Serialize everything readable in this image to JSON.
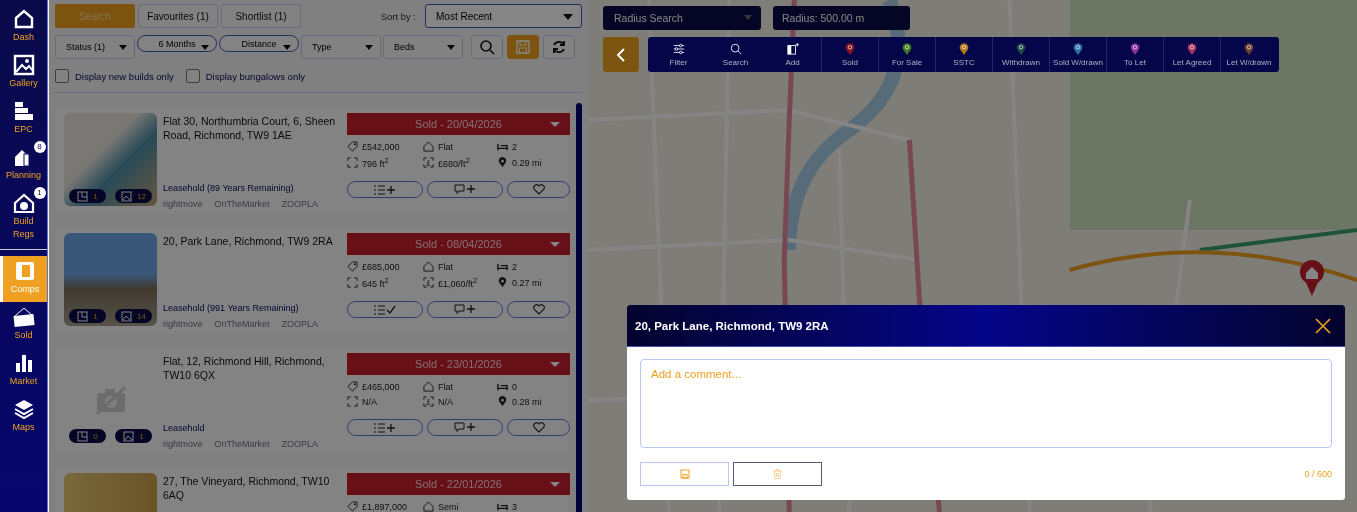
{
  "sidebar": {
    "items": [
      {
        "label": "Dash",
        "selected": false
      },
      {
        "label": "Gallery",
        "selected": false
      },
      {
        "label": "EPC",
        "selected": false
      },
      {
        "label": "Planning",
        "selected": false,
        "badge": "8"
      },
      {
        "label": "Build Regs",
        "selected": false,
        "badge": "1"
      },
      {
        "label": "Comps",
        "selected": true
      },
      {
        "label": "Sold",
        "selected": false
      },
      {
        "label": "Market",
        "selected": false
      },
      {
        "label": "Maps",
        "selected": false
      }
    ]
  },
  "tabs": [
    {
      "label": "Search",
      "selected": true
    },
    {
      "label": "Favourites (1)",
      "selected": false
    },
    {
      "label": "Shortlist (1)",
      "selected": false
    }
  ],
  "sort": {
    "label": "Sort by :",
    "value": "Most Recent"
  },
  "filters": [
    {
      "label": "Status (1)",
      "active": false
    },
    {
      "label": "6 Months",
      "active": true
    },
    {
      "label": "Distance",
      "active": true
    },
    {
      "label": "Type",
      "active": false
    },
    {
      "label": "Beds",
      "active": false
    }
  ],
  "checkboxes": [
    {
      "label": "Display new builds only",
      "checked": false
    },
    {
      "label": "Display bungalows only",
      "checked": false
    }
  ],
  "listings": [
    {
      "address": "Flat 30, Northumbria Court, 6, Sheen Road, Richmond, TW9 1AE",
      "status": "Sold - 20/04/2026",
      "price": "£542,000",
      "type": "Flat",
      "beds": "2",
      "area": "796 ft$^{2}$",
      "price_per_area": "£680/ft$^{2}$",
      "distance": "0.29 mi",
      "tenure": "Leasehold (89 Years Remaining)",
      "floorplans": "1",
      "photos": "12",
      "has_photo": true,
      "shortlisted": false,
      "portals": [
        "rightmove",
        "OnTheMarket",
        "ZOOPLA"
      ]
    },
    {
      "address": "20, Park Lane, Richmond, TW9 2RA",
      "status": "Sold - 08/04/2026",
      "price": "£685,000",
      "type": "Flat",
      "beds": "2",
      "area": "645 ft$^{2}$",
      "price_per_area": "£1,060/ft$^{2}$",
      "distance": "0.27 mi",
      "tenure": "Leasehold (991 Years Remaining)",
      "floorplans": "1",
      "photos": "14",
      "has_photo": true,
      "shortlisted": true,
      "portals": [
        "rightmove",
        "OnTheMarket",
        "ZOOPLA"
      ]
    },
    {
      "address": "Flat, 12, Richmond Hill, Richmond, TW10 6QX",
      "status": "Sold - 23/01/2026",
      "price": "£465,000",
      "type": "Flat",
      "beds": "0",
      "area": "N/A",
      "price_per_area": "N/A",
      "distance": "0.28 mi",
      "tenure": "Leasehold",
      "floorplans": "0",
      "photos": "1",
      "has_photo": false,
      "shortlisted": false,
      "portals": [
        "rightmove",
        "OnTheMarket",
        "ZOOPLA"
      ]
    },
    {
      "address": "27, The Vineyard, Richmond, TW10 6AQ",
      "status": "Sold - 22/01/2026",
      "price": "£1,897,000",
      "type": "Semi",
      "beds": "3",
      "has_photo": true
    }
  ],
  "map": {
    "search_mode": "Radius Search",
    "radius": "Radius: 500.00 m",
    "toolbar": [
      {
        "kind": "tool",
        "label": "Filter"
      },
      {
        "kind": "tool",
        "label": "Search"
      },
      {
        "kind": "tool",
        "label": "Add"
      },
      {
        "kind": "marker",
        "label": "Sold",
        "color": "#8a1520"
      },
      {
        "kind": "marker",
        "label": "For Sale",
        "color": "#3f7a1e"
      },
      {
        "kind": "marker",
        "label": "SSTC",
        "color": "#b07516"
      },
      {
        "kind": "marker",
        "label": "Withdrawn",
        "color": "#1c4a46"
      },
      {
        "kind": "marker",
        "label": "Sold W/drawn",
        "color": "#2f6fa8"
      },
      {
        "kind": "marker",
        "label": "To Let",
        "color": "#8a339a"
      },
      {
        "kind": "marker",
        "label": "Let Agreed",
        "color": "#ad3462"
      },
      {
        "kind": "marker",
        "label": "Let W/drawn",
        "color": "#6c3e32"
      }
    ]
  },
  "comment_dialog": {
    "title": "20, Park Lane, Richmond, TW9 2RA",
    "placeholder": "Add a comment...",
    "counter": "0 / 600"
  }
}
